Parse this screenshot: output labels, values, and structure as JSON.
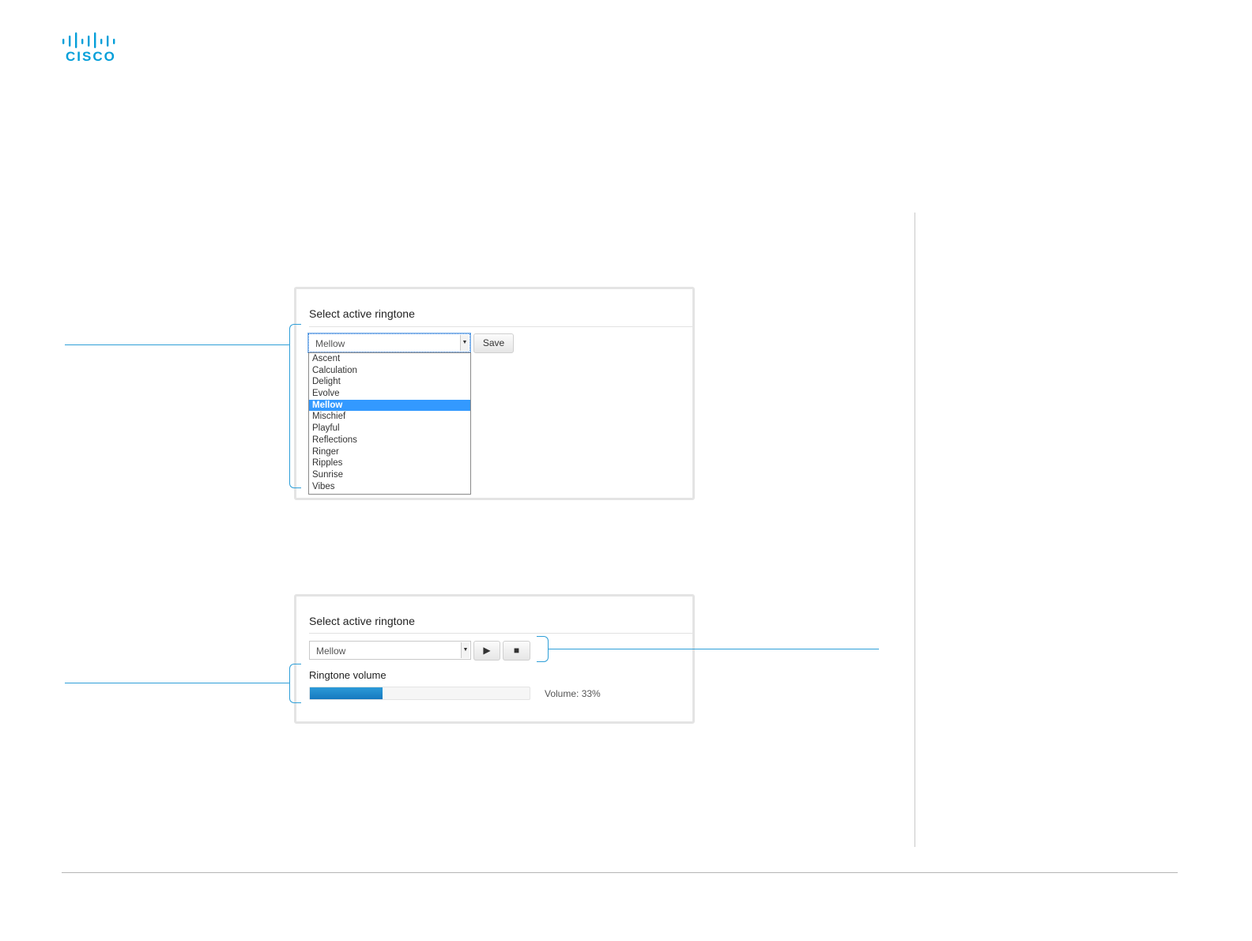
{
  "logo": {
    "text": "CISCO",
    "color": "#049fd9"
  },
  "panel_top": {
    "title": "Select active ringtone",
    "select_value": "Mellow",
    "save_label": "Save",
    "options": [
      "Ascent",
      "Calculation",
      "Delight",
      "Evolve",
      "Mellow",
      "Mischief",
      "Playful",
      "Reflections",
      "Ringer",
      "Ripples",
      "Sunrise",
      "Vibes"
    ],
    "selected_option": "Mellow"
  },
  "panel_bottom": {
    "title": "Select active ringtone",
    "select_value": "Mellow",
    "play_icon": "play-icon",
    "stop_icon": "stop-icon",
    "volume_label": "Ringtone volume",
    "volume_percent": 33,
    "volume_text": "Volume: 33%"
  },
  "colors": {
    "accent": "#2f9fd8",
    "selection": "#3399ff",
    "volume_fill": "#1a86c8"
  }
}
